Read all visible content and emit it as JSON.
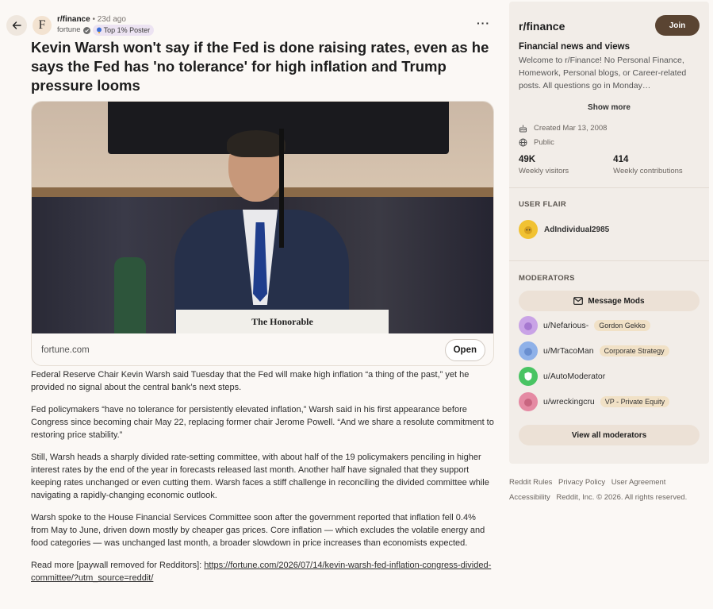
{
  "post": {
    "subreddit": "r/finance",
    "time": "23d ago",
    "author": "fortune",
    "author_flair": "Top 1% Poster",
    "subreddit_avatar_letter": "F",
    "title": "Kevin Warsh won't say if the Fed is done raising rates, even as he says the Fed has 'no tolerance' for high inflation and Trump pressure looms",
    "more_icon": "···"
  },
  "link_card": {
    "image_caption": "The Honorable",
    "domain": "fortune.com",
    "open_label": "Open"
  },
  "body": {
    "paragraphs": [
      "Federal Reserve Chair Kevin Warsh said Tuesday that the Fed will make high inflation “a thing of the past,” yet he provided no signal about the central bank’s next steps.",
      "Fed policymakers “have no tolerance for persistently elevated inflation,” Warsh said in his first appearance before Congress since becoming chair May 22, replacing former chair Jerome Powell. “And we share a resolute commitment to restoring price stability.”",
      "Still, Warsh heads a sharply divided rate-setting committee, with about half of the 19 policymakers penciling in higher interest rates by the end of the year in forecasts released last month. Another half have signaled that they support keeping rates unchanged or even cutting them. Warsh faces a stiff challenge in reconciling the divided committee while navigating a rapidly-changing economic outlook.",
      "Warsh spoke to the House Financial Services Committee soon after the government reported that inflation fell 0.4% from May to June, driven down mostly by cheaper gas prices. Core inflation — which excludes the volatile energy and food categories — was unchanged last month, a broader slowdown in price increases than economists expected."
    ],
    "read_more_label": "Read more [paywall removed for Redditors]: ",
    "read_more_url": "https://fortune.com/2026/07/14/kevin-warsh-fed-inflation-congress-divided-committee/?utm_source=reddit/"
  },
  "sidebar": {
    "subreddit": "r/finance",
    "join_label": "Join",
    "title": "Financial news and views",
    "description": "Welcome to r/Finance! No Personal Finance, Homework, Personal blogs, or Career-related posts. All questions go in Monday…",
    "show_more": "Show more",
    "created": "Created Mar 13, 2008",
    "visibility": "Public",
    "stats": [
      {
        "value": "49K",
        "label": "Weekly visitors"
      },
      {
        "value": "414",
        "label": "Weekly contributions"
      }
    ],
    "user_flair_heading": "USER FLAIR",
    "flair_username": "AdIndividual2985",
    "moderators_heading": "MODERATORS",
    "message_mods": "Message Mods",
    "moderators": [
      {
        "name": "u/Nefarious-",
        "flair": "Gordon Gekko",
        "color": "#c9a3e6"
      },
      {
        "name": "u/MrTacoMan",
        "flair": "Corporate Strategy",
        "color": "#8fb1e8"
      },
      {
        "name": "u/AutoModerator",
        "flair": "",
        "color": "#49c463"
      },
      {
        "name": "u/wreckingcru",
        "flair": "VP - Private Equity",
        "color": "#e58aa3"
      }
    ],
    "view_all_mods": "View all moderators"
  },
  "footer": {
    "links": [
      "Reddit Rules",
      "Privacy Policy",
      "User Agreement",
      "Accessibility",
      "Reddit, Inc. © 2026. All rights reserved."
    ]
  },
  "colors": {
    "join_button": "#5a4432",
    "background": "#fbf8f5",
    "sidebar": "#f2ede8"
  }
}
